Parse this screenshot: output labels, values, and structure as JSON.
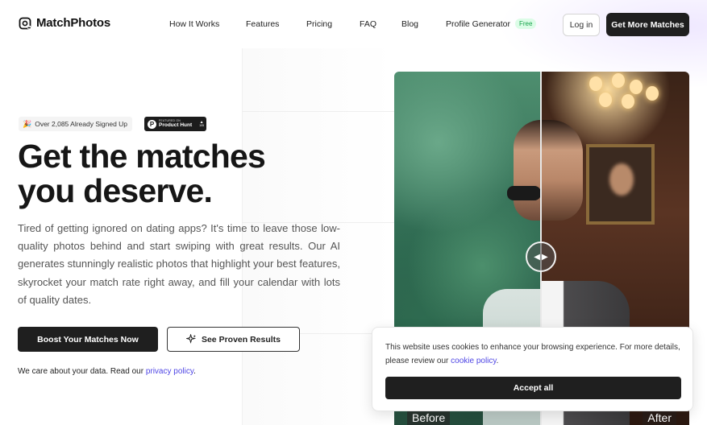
{
  "brand": {
    "name": "MatchPhotos"
  },
  "nav": {
    "links": [
      "How It Works",
      "Features",
      "Pricing",
      "FAQ",
      "Blog",
      "Profile Generator"
    ],
    "free_badge": "Free",
    "login_label": "Log in",
    "cta_label": "Get More Matches"
  },
  "hero": {
    "signed_up_badge": "Over 2,085 Already Signed Up",
    "product_hunt": {
      "small": "FEATURED ON",
      "name": "Product Hunt",
      "count": "105"
    },
    "headline_line1": "Get the matches",
    "headline_line2": "you deserve.",
    "body": "Tired of getting ignored on dating apps? It's time to leave those low-quality photos behind and start swiping with great results. Our AI generates stunningly realistic photos that highlight your best features, skyrocket your match rate right away, and fill your calendar with lots of quality dates.",
    "primary_button": "Boost Your Matches Now",
    "secondary_button": "See Proven Results",
    "privacy_prefix": "We care about your data. Read our",
    "privacy_link": "privacy policy",
    "privacy_suffix": "."
  },
  "compare": {
    "before_label": "Before",
    "after_label": "After",
    "slider_position": 0.5
  },
  "cookie": {
    "text": "This website uses cookies to enhance your browsing experience. For more details, please review our",
    "link": "cookie policy",
    "suffix": ".",
    "accept_label": "Accept all"
  },
  "colors": {
    "primary_dark": "#1f1f1f",
    "link": "#4f46e5",
    "free_green": "#16a34a"
  }
}
